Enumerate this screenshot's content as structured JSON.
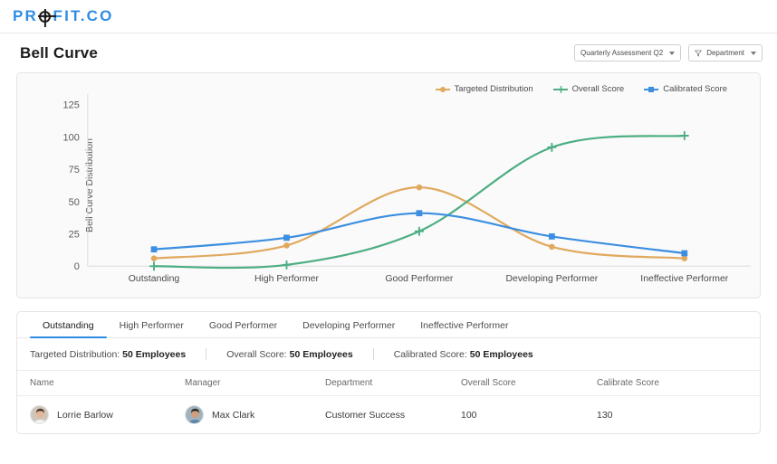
{
  "brand": {
    "text_1": "PR",
    "text_2": "FIT.CO",
    "icon": "target-icon",
    "color": "#2f8de4"
  },
  "header": {
    "title": "Bell Curve",
    "assessment_dropdown": "Quarterly Assessment Q2",
    "department_dropdown": "Department",
    "filter_icon": "funnel-icon",
    "caret_icon": "chevron-down-icon"
  },
  "chart_data": {
    "type": "line",
    "title": "",
    "xlabel": "",
    "ylabel": "Bell Curve Distribution",
    "categories": [
      "Outstanding",
      "High Performer",
      "Good Performer",
      "Developing Performer",
      "Ineffective Performer"
    ],
    "ylim": [
      0,
      125
    ],
    "yticks": [
      0,
      25,
      50,
      75,
      100,
      125
    ],
    "grid": false,
    "legend_position": "top-right",
    "series": [
      {
        "name": "Targeted Distribution",
        "color": "#e0a95e",
        "marker": "circle",
        "values": [
          6,
          16,
          61,
          15,
          6
        ]
      },
      {
        "name": "Overall Score",
        "color": "#4cae82",
        "marker": "cross",
        "values": [
          0,
          1,
          27,
          92,
          101
        ]
      },
      {
        "name": "Calibrated Score",
        "color": "#3b8ee0",
        "marker": "square",
        "values": [
          13,
          22,
          41,
          23,
          10
        ]
      }
    ]
  },
  "tabs": [
    {
      "label": "Outstanding",
      "active": true
    },
    {
      "label": "High Performer",
      "active": false
    },
    {
      "label": "Good Performer",
      "active": false
    },
    {
      "label": "Developing Performer",
      "active": false
    },
    {
      "label": "Ineffective Performer",
      "active": false
    }
  ],
  "stats": [
    {
      "label": "Targeted Distribution:",
      "value": "50 Employees"
    },
    {
      "label": "Overall Score:",
      "value": "50 Employees"
    },
    {
      "label": "Calibrated Score:",
      "value": "50 Employees"
    }
  ],
  "table": {
    "columns": [
      "Name",
      "Manager",
      "Department",
      "Overall Score",
      "Calibrate Score"
    ],
    "rows": [
      {
        "name": "Lorrie Barlow",
        "manager": "Max Clark",
        "department": "Customer Success",
        "overall_score": "100",
        "calibrate_score": "130"
      }
    ]
  }
}
